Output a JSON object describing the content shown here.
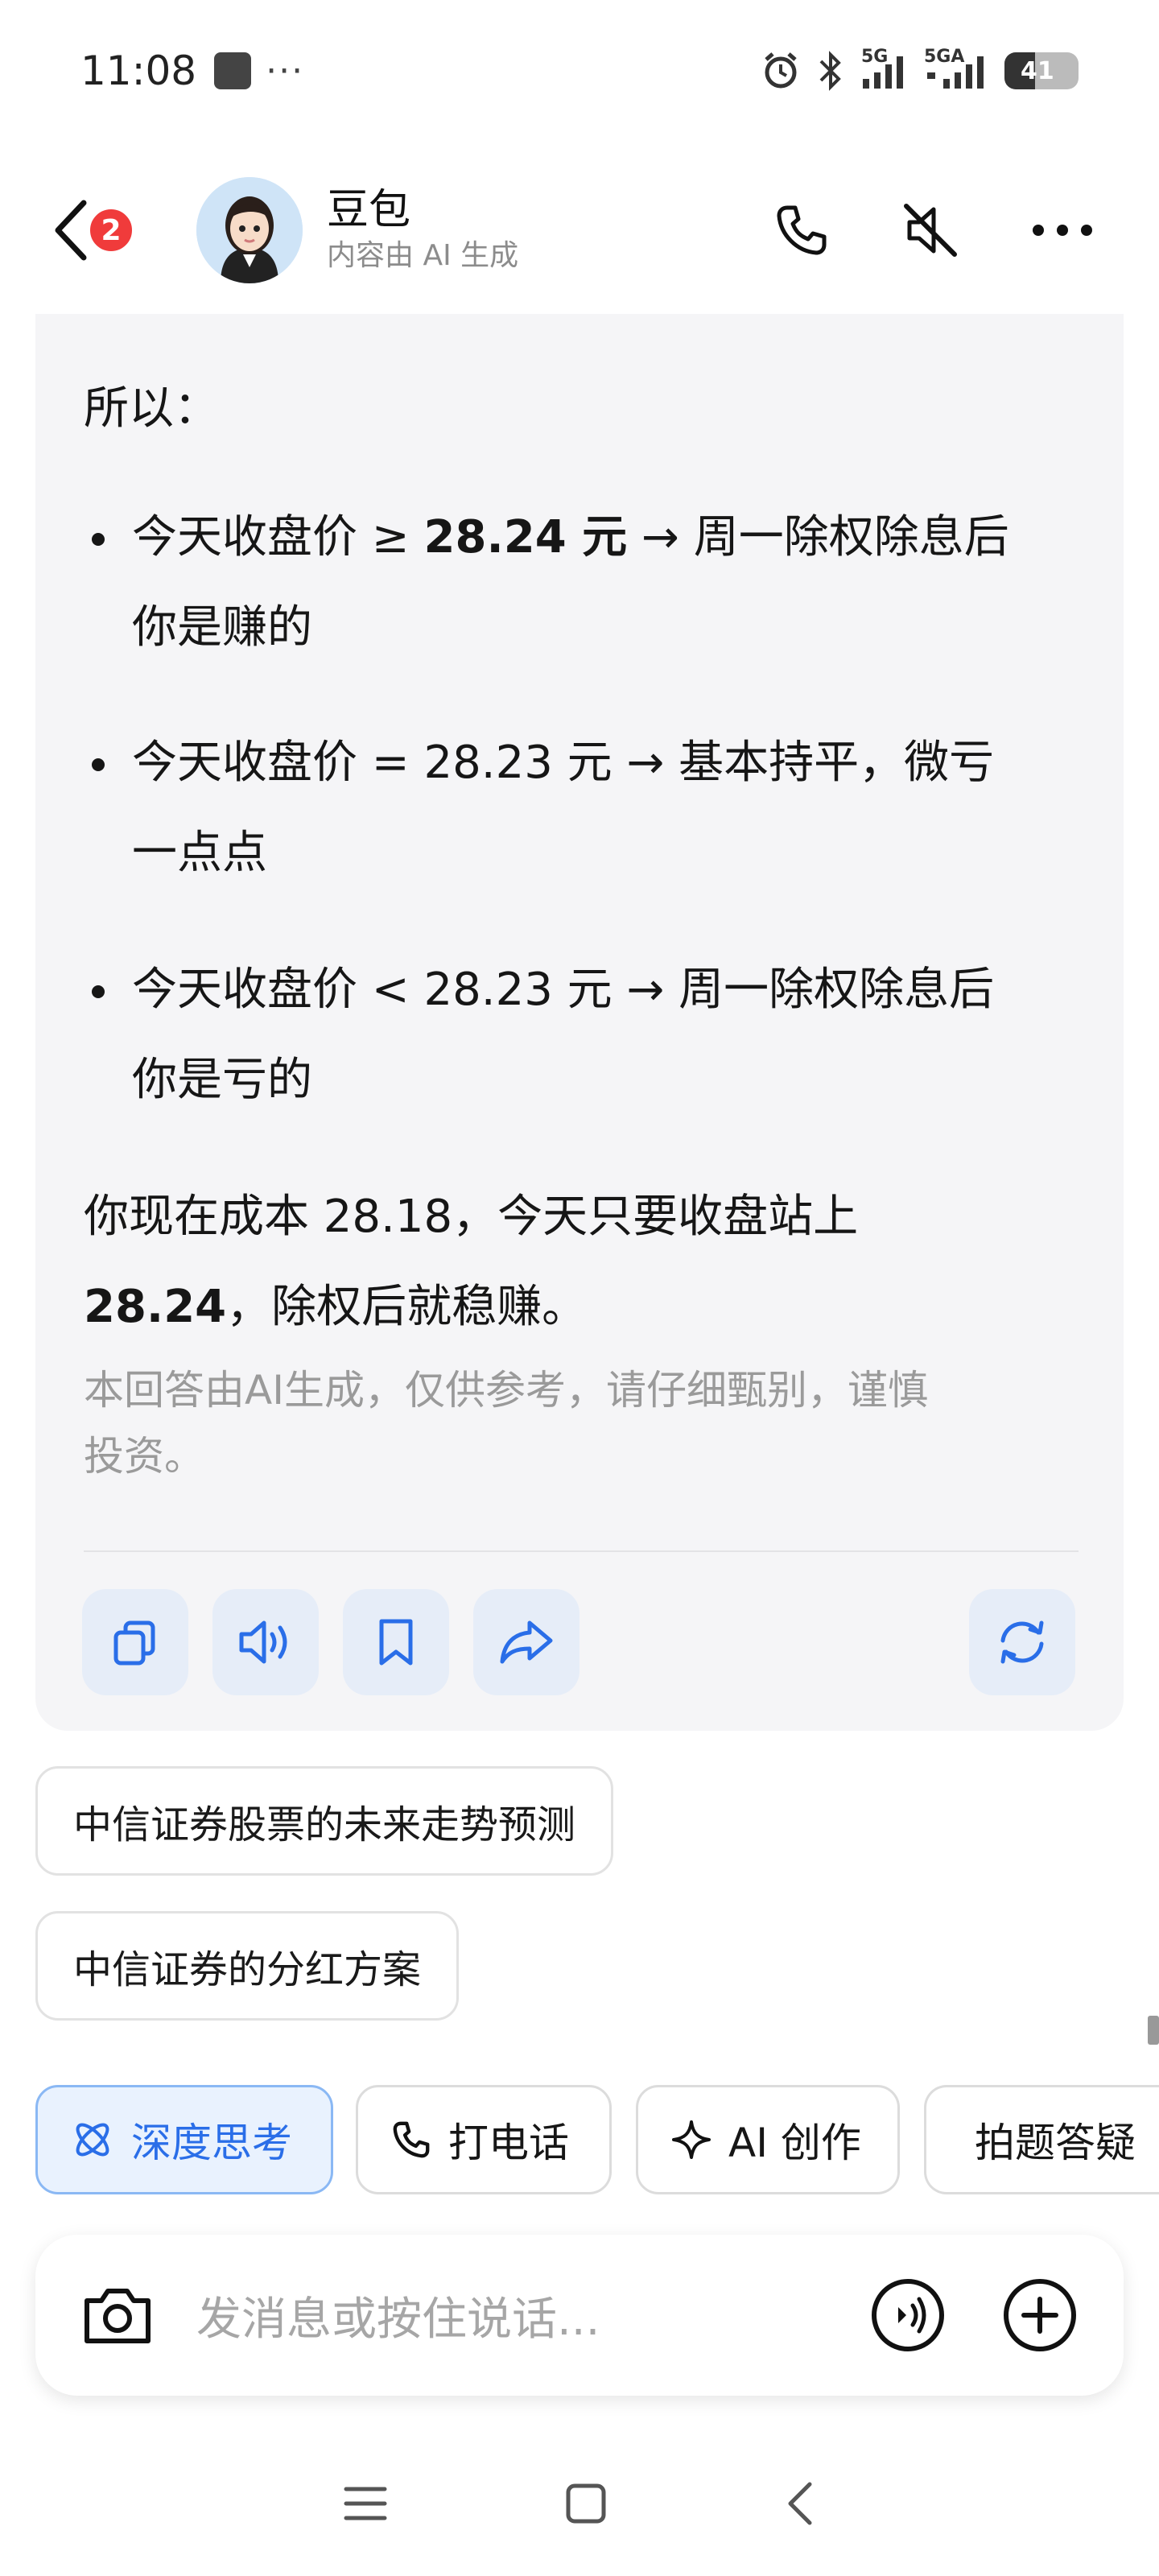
{
  "status_bar": {
    "time": "11:08",
    "more": "···",
    "signal_1": "5G",
    "signal_2": "5GA",
    "battery": "41"
  },
  "header": {
    "unread_badge": "2",
    "bot_name": "豆包",
    "bot_subtitle": "内容由 AI 生成"
  },
  "answer": {
    "intro": "所以：",
    "bullets": [
      {
        "line1_a": "今天收盘价 ≥ ",
        "line1_bold": "28.24 元",
        "line1_b": " → 周一除权除息后",
        "line2": "你是赚的"
      },
      {
        "line1": "今天收盘价 = 28.23 元 → 基本持平，微亏",
        "line2": "一点点"
      },
      {
        "line1": "今天收盘价 < 28.23 元 → 周一除权除息后",
        "line2": "你是亏的"
      }
    ],
    "conclusion_line1": "你现在成本 28.18，今天只要收盘站上",
    "conclusion_bold": "28.24",
    "conclusion_rest": "，除权后就稳赚。",
    "disclaimer_line1": "本回答由AI生成，仅供参考，请仔细甄别，谨慎",
    "disclaimer_line2": "投资。"
  },
  "suggestions": [
    "中信证券股票的未来走势预测",
    "中信证券的分红方案"
  ],
  "chips": [
    {
      "label": "深度思考",
      "icon": "atom-icon",
      "active": true
    },
    {
      "label": "打电话",
      "icon": "phone-icon",
      "active": false
    },
    {
      "label": "AI 创作",
      "icon": "sparkle-icon",
      "active": false
    },
    {
      "label": "拍题答疑",
      "icon": "scan-doc-icon",
      "active": false
    }
  ],
  "input": {
    "placeholder": "发消息或按住说话..."
  },
  "colors": {
    "accent": "#2a6ee8",
    "badge": "#f03b3b",
    "card_bg": "#f5f5f7"
  }
}
